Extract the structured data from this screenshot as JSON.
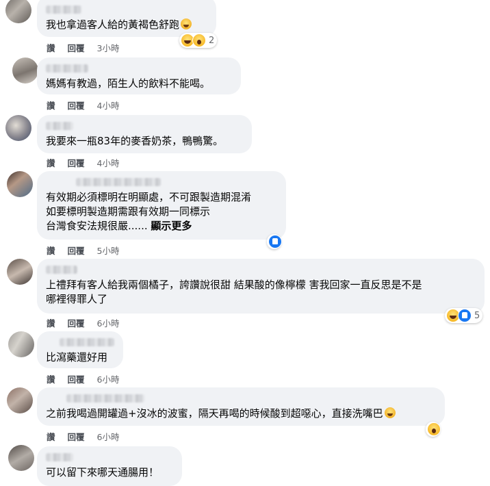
{
  "actions": {
    "like": "讚",
    "reply": "回覆"
  },
  "comments": [
    {
      "text": "我也拿過客人給的黃褐色舒跑",
      "time": "3小時",
      "reactions": {
        "types": [
          "haha-icon",
          "wow-icon"
        ],
        "count": "2"
      },
      "inline_emoji": "grinning-sweat-emoji"
    },
    {
      "text": "媽媽有教過，陌生人的飲料不能喝。",
      "time": "4小時"
    },
    {
      "text": "我要來一瓶83年的麥香奶茶，鴨鴨驚。",
      "time": "4小時"
    },
    {
      "text": "有效期必須標明在明顯處，不可跟製造期混淆\n如要標明製造期需跟有效期一同標示\n台灣食安法規很嚴......",
      "more": "顯示更多",
      "time": "5小時",
      "reactions": {
        "types": [
          "like-icon"
        ]
      }
    },
    {
      "text": "上禮拜有客人給我兩個橘子，誇讚說很甜 結果酸的像檸檬 害我回家一直反思是不是\n哪裡得罪人了",
      "time": "6小時",
      "reactions": {
        "types": [
          "haha-icon",
          "like-icon"
        ],
        "count": "5"
      }
    },
    {
      "text": "比瀉藥還好用",
      "time": "6小時"
    },
    {
      "text": "之前我喝過開罐過+沒冰的波蜜，隔天再喝的時候酸到超噁心，直接洗嘴巴",
      "time": "6小時",
      "reactions": {
        "types": [
          "wow-icon"
        ]
      },
      "inline_emoji": "grinning-sweat-emoji"
    },
    {
      "text": "可以留下來哪天通腸用！"
    }
  ]
}
